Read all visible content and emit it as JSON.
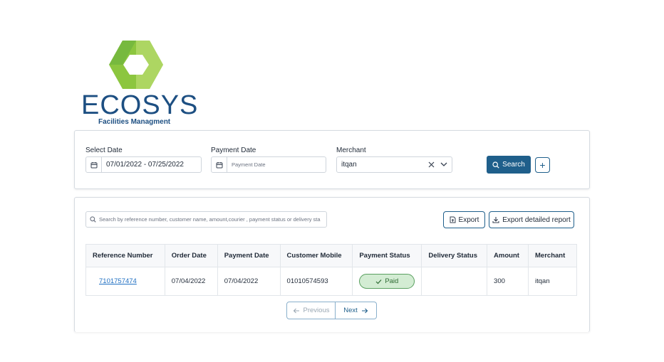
{
  "logo": {
    "word": "ECOSYS",
    "subtitle": "Facilities Managment"
  },
  "filters": {
    "select_date": {
      "label": "Select Date",
      "value": "07/01/2022 - 07/25/2022"
    },
    "payment_date": {
      "label": "Payment Date",
      "placeholder": "Payment Date"
    },
    "merchant": {
      "label": "Merchant",
      "value": "itqan"
    },
    "search_label": "Search",
    "add_label": "+"
  },
  "toolbar": {
    "search_placeholder": "Search by reference number, customer name, amount,courier , payment status or delivery sta",
    "export_label": "Export",
    "export_detailed_label": "Export detailed report"
  },
  "table": {
    "headers": [
      "Reference Number",
      "Order Date",
      "Payment Date",
      "Customer Mobile",
      "Payment Status",
      "Delivery Status",
      "Amount",
      "Merchant"
    ],
    "rows": [
      {
        "reference": "7101757474",
        "order_date": "07/04/2022",
        "payment_date": "07/04/2022",
        "mobile": "01010574593",
        "payment_status": "Paid",
        "delivery_status": "",
        "amount": "300",
        "merchant": "itqan"
      }
    ]
  },
  "pagination": {
    "previous_label": "Previous",
    "next_label": "Next"
  },
  "colors": {
    "primary": "#1f5f8b",
    "logo_blue": "#1d4f82",
    "logo_green": "#8cc63f",
    "paid_bg": "#d3ecd3"
  },
  "icons": [
    "calendar-icon",
    "clear-icon",
    "chevron-down-icon",
    "search-icon",
    "plus-icon",
    "file-export-icon",
    "download-icon",
    "check-icon",
    "arrow-left-icon",
    "arrow-right-icon"
  ]
}
